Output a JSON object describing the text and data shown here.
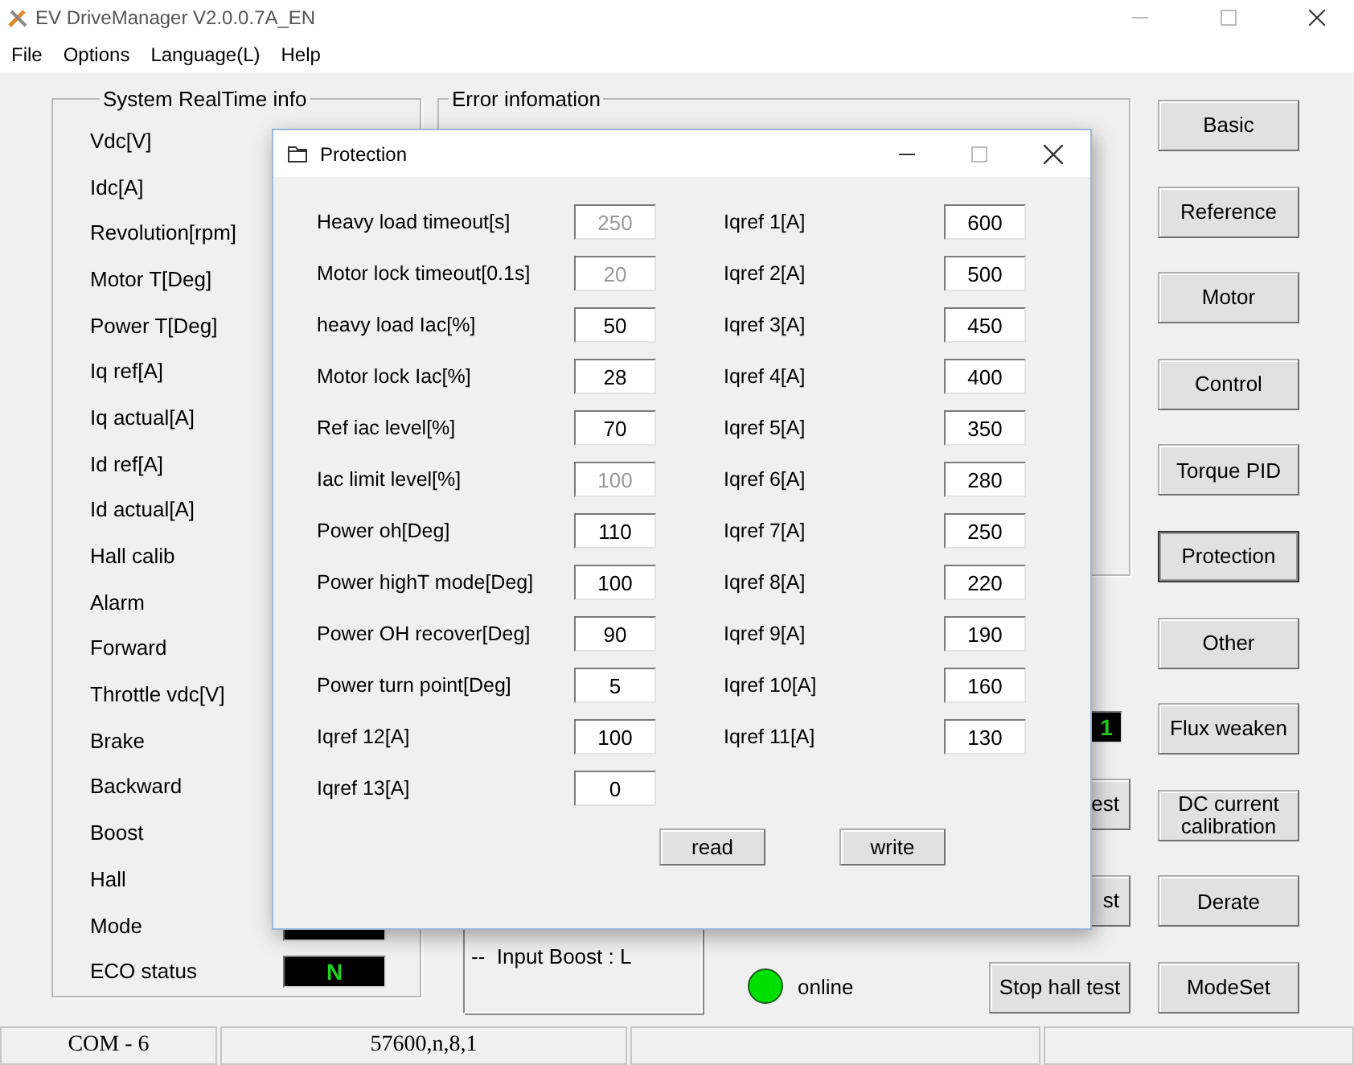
{
  "window": {
    "title": "EV DriveManager V2.0.0.7A_EN"
  },
  "menu": [
    "File",
    "Options",
    "Language(L)",
    "Help"
  ],
  "realtime_panel": {
    "title": "System RealTime info",
    "rows": [
      {
        "kind": "label",
        "label": "Vdc[V]"
      },
      {
        "kind": "label",
        "label": "Idc[A]"
      },
      {
        "kind": "label",
        "label": "Revolution[rpm]"
      },
      {
        "kind": "label",
        "label": "Motor T[Deg]"
      },
      {
        "kind": "label",
        "label": "Power T[Deg]"
      },
      {
        "kind": "label",
        "label": "Iq ref[A]"
      },
      {
        "kind": "label",
        "label": "Iq actual[A]"
      },
      {
        "kind": "label",
        "label": "Id ref[A]"
      },
      {
        "kind": "label",
        "label": "Id actual[A]"
      },
      {
        "kind": "label",
        "label": "Hall calib"
      },
      {
        "kind": "label",
        "label": "Alarm"
      },
      {
        "kind": "label",
        "label": "Forward"
      },
      {
        "kind": "label",
        "label": "Throttle vdc[V]"
      },
      {
        "kind": "label",
        "label": "Brake"
      },
      {
        "kind": "label",
        "label": "Backward"
      },
      {
        "kind": "label",
        "label": "Boost"
      },
      {
        "kind": "label",
        "label": "Hall"
      },
      {
        "kind": "display",
        "label": "Mode"
      },
      {
        "kind": "display",
        "label": "ECO status",
        "value": "N"
      }
    ]
  },
  "error_panel": {
    "title": "Error infomation",
    "input_lines": [
      "--  Input Boost : L"
    ]
  },
  "middle_controls": {
    "display_value": "1",
    "buttons": [
      "est",
      "st",
      "Stop hall test"
    ]
  },
  "status_indicator": {
    "label": "online",
    "on": true
  },
  "side_buttons": [
    {
      "label": "Basic",
      "selected": false
    },
    {
      "label": "Reference",
      "selected": false
    },
    {
      "label": "Motor",
      "selected": false
    },
    {
      "label": "Control",
      "selected": false
    },
    {
      "label": "Torque PID",
      "selected": false
    },
    {
      "label": "Protection",
      "selected": true
    },
    {
      "label": "Other",
      "selected": false
    },
    {
      "label": "Flux weaken",
      "selected": false
    },
    {
      "label": "DC current calibration",
      "selected": false
    },
    {
      "label": "Derate",
      "selected": false
    },
    {
      "label": "ModeSet",
      "selected": false
    }
  ],
  "status_bar": [
    "COM - 6",
    "57600,n,8,1"
  ],
  "dialog": {
    "title": "Protection",
    "left_fields": [
      {
        "label": "Heavy load timeout[s]",
        "value": "250",
        "disabled": true
      },
      {
        "label": "Motor lock timeout[0.1s]",
        "value": "20",
        "disabled": true
      },
      {
        "label": "heavy load Iac[%]",
        "value": "50",
        "disabled": false
      },
      {
        "label": "Motor lock Iac[%]",
        "value": "28",
        "disabled": false
      },
      {
        "label": "Ref iac level[%]",
        "value": "70",
        "disabled": false
      },
      {
        "label": "Iac limit level[%]",
        "value": "100",
        "disabled": true
      },
      {
        "label": "Power oh[Deg]",
        "value": "110",
        "disabled": false
      },
      {
        "label": "Power highT mode[Deg]",
        "value": "100",
        "disabled": false
      },
      {
        "label": "Power OH recover[Deg]",
        "value": "90",
        "disabled": false
      },
      {
        "label": "Power turn point[Deg]",
        "value": "5",
        "disabled": false
      },
      {
        "label": "Iqref 12[A]",
        "value": "100",
        "disabled": false
      },
      {
        "label": "Iqref 13[A]",
        "value": "0",
        "disabled": false
      }
    ],
    "right_fields": [
      {
        "label": "Iqref 1[A]",
        "value": "600",
        "disabled": false
      },
      {
        "label": "Iqref 2[A]",
        "value": "500",
        "disabled": false
      },
      {
        "label": "Iqref 3[A]",
        "value": "450",
        "disabled": false
      },
      {
        "label": "Iqref 4[A]",
        "value": "400",
        "disabled": false
      },
      {
        "label": "Iqref 5[A]",
        "value": "350",
        "disabled": false
      },
      {
        "label": "Iqref 6[A]",
        "value": "280",
        "disabled": false
      },
      {
        "label": "Iqref 7[A]",
        "value": "250",
        "disabled": false
      },
      {
        "label": "Iqref 8[A]",
        "value": "220",
        "disabled": false
      },
      {
        "label": "Iqref 9[A]",
        "value": "190",
        "disabled": false
      },
      {
        "label": "Iqref 10[A]",
        "value": "160",
        "disabled": false
      },
      {
        "label": "Iqref 11[A]",
        "value": "130",
        "disabled": false
      }
    ],
    "buttons": [
      "read",
      "write"
    ]
  }
}
